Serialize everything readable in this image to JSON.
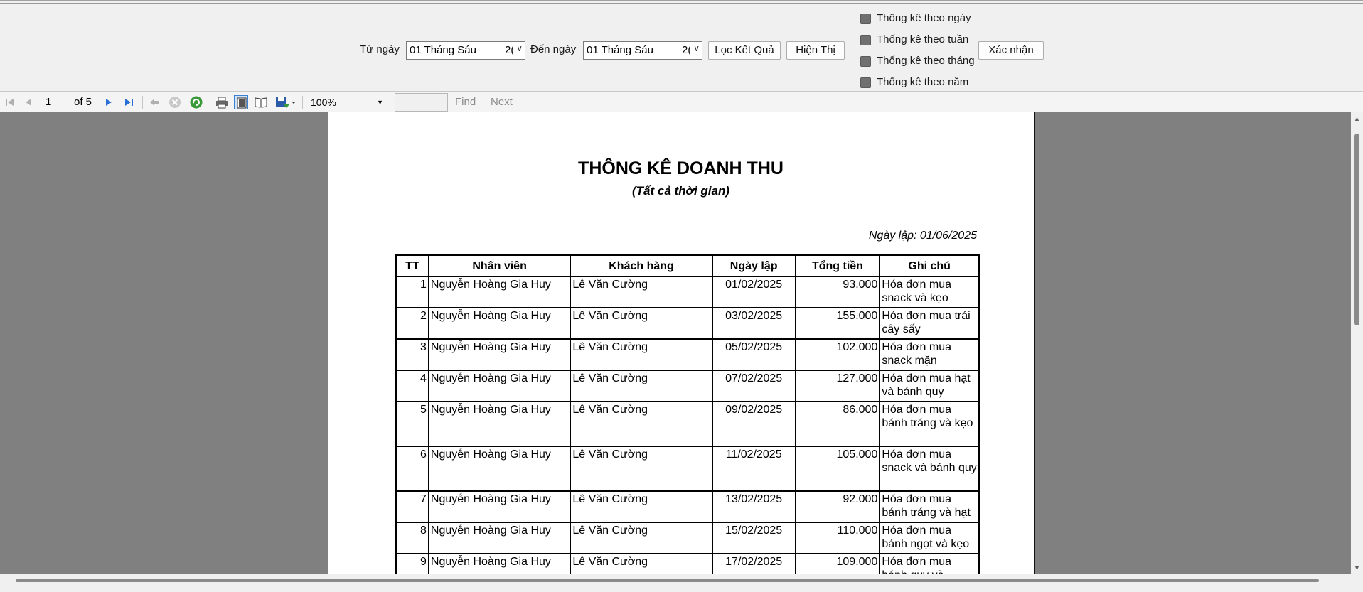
{
  "filters": {
    "from_label": "Từ ngày",
    "from_date_text": "01      Tháng Sáu",
    "from_year_partial": "2(",
    "to_label": "Đến ngày",
    "to_date_text": "01      Tháng Sáu",
    "to_year_partial": "2(",
    "filter_button": "Lọc Kết Quả",
    "show_button": "Hiện Thị",
    "confirm_button": "Xác nhận",
    "checkboxes": [
      {
        "label": "Thông kê theo ngày",
        "checked": false
      },
      {
        "label": "Thống kê theo tuần",
        "checked": false
      },
      {
        "label": "Thống kê theo tháng",
        "checked": false
      },
      {
        "label": "Thống kê theo năm",
        "checked": false
      }
    ]
  },
  "toolbar": {
    "page_current": "1",
    "page_of": "of 5",
    "zoom": "100%",
    "find_value": "",
    "find_label": "Find",
    "next_label": "Next"
  },
  "report": {
    "title": "THÔNG KÊ DOANH THU",
    "subtitle": "(Tất cả thời gian)",
    "created_label": "Ngày lập: 01/06/2025",
    "columns": [
      "TT",
      "Nhân viên",
      "Khách hàng",
      "Ngày lập",
      "Tổng tiền",
      "Ghi chú"
    ],
    "rows": [
      {
        "tt": "1",
        "employee": "Nguyễn Hoàng Gia Huy",
        "customer": "Lê Văn Cường",
        "date": "01/02/2025",
        "total": "93.000",
        "note": "Hóa đơn mua snack và kẹo"
      },
      {
        "tt": "2",
        "employee": "Nguyễn Hoàng Gia Huy",
        "customer": "Lê Văn Cường",
        "date": "03/02/2025",
        "total": "155.000",
        "note": "Hóa đơn mua trái cây sấy"
      },
      {
        "tt": "3",
        "employee": "Nguyễn Hoàng Gia Huy",
        "customer": "Lê Văn Cường",
        "date": "05/02/2025",
        "total": "102.000",
        "note": "Hóa đơn mua snack mặn"
      },
      {
        "tt": "4",
        "employee": "Nguyễn Hoàng Gia Huy",
        "customer": "Lê Văn Cường",
        "date": "07/02/2025",
        "total": "127.000",
        "note": "Hóa đơn mua hạt và bánh quy"
      },
      {
        "tt": "5",
        "employee": "Nguyễn Hoàng Gia Huy",
        "customer": "Lê Văn Cường",
        "date": "09/02/2025",
        "total": "86.000",
        "note": "Hóa đơn mua bánh tráng và kẹo"
      },
      {
        "tt": "6",
        "employee": "Nguyễn Hoàng Gia Huy",
        "customer": "Lê Văn Cường",
        "date": "11/02/2025",
        "total": "105.000",
        "note": "Hóa đơn mua snack và bánh quy"
      },
      {
        "tt": "7",
        "employee": "Nguyễn Hoàng Gia Huy",
        "customer": "Lê Văn Cường",
        "date": "13/02/2025",
        "total": "92.000",
        "note": "Hóa đơn mua bánh tráng và hạt"
      },
      {
        "tt": "8",
        "employee": "Nguyễn Hoàng Gia Huy",
        "customer": "Lê Văn Cường",
        "date": "15/02/2025",
        "total": "110.000",
        "note": "Hóa đơn mua bánh ngọt và kẹo"
      },
      {
        "tt": "9",
        "employee": "Nguyễn Hoàng Gia Huy",
        "customer": "Lê Văn Cường",
        "date": "17/02/2025",
        "total": "109.000",
        "note": "Hóa đơn mua bánh quy và"
      }
    ]
  },
  "colors": {
    "viewer_bg": "#808080",
    "toolbar_icon_blue": "#2a6fd6",
    "disabled_icon": "#b0b0b0"
  }
}
